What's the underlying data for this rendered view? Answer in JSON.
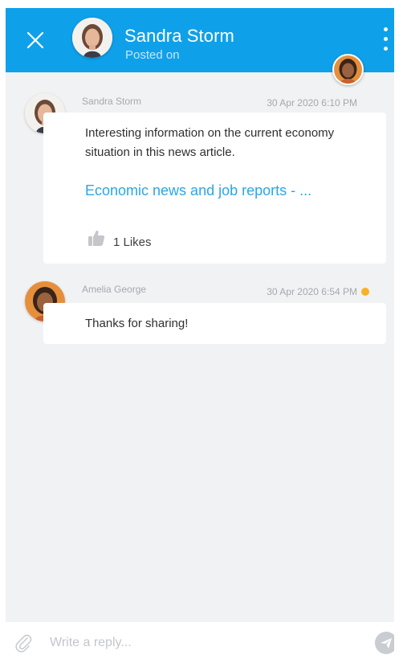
{
  "header": {
    "title": "Sandra Storm",
    "subtitle": "Posted on",
    "close_icon": "close-icon",
    "menu_icon": "more-vertical-icon",
    "color": "#0fa0ea"
  },
  "messages": [
    {
      "author": "Sandra Storm",
      "timestamp": "30 Apr 2020 6:10 PM",
      "text": "Interesting information on the current economy situation in this news article.",
      "link_text": "Economic news and job reports - ...",
      "likes_label": "1 Likes",
      "like_icon": "thumbs-up-icon"
    },
    {
      "author": "Amelia George",
      "timestamp": "30 Apr 2020 6:54 PM",
      "text": "Thanks for sharing!",
      "status_color": "#f9b126"
    }
  ],
  "reply": {
    "placeholder": "Write a reply...",
    "attach_icon": "paperclip-icon",
    "send_icon": "send-icon"
  }
}
